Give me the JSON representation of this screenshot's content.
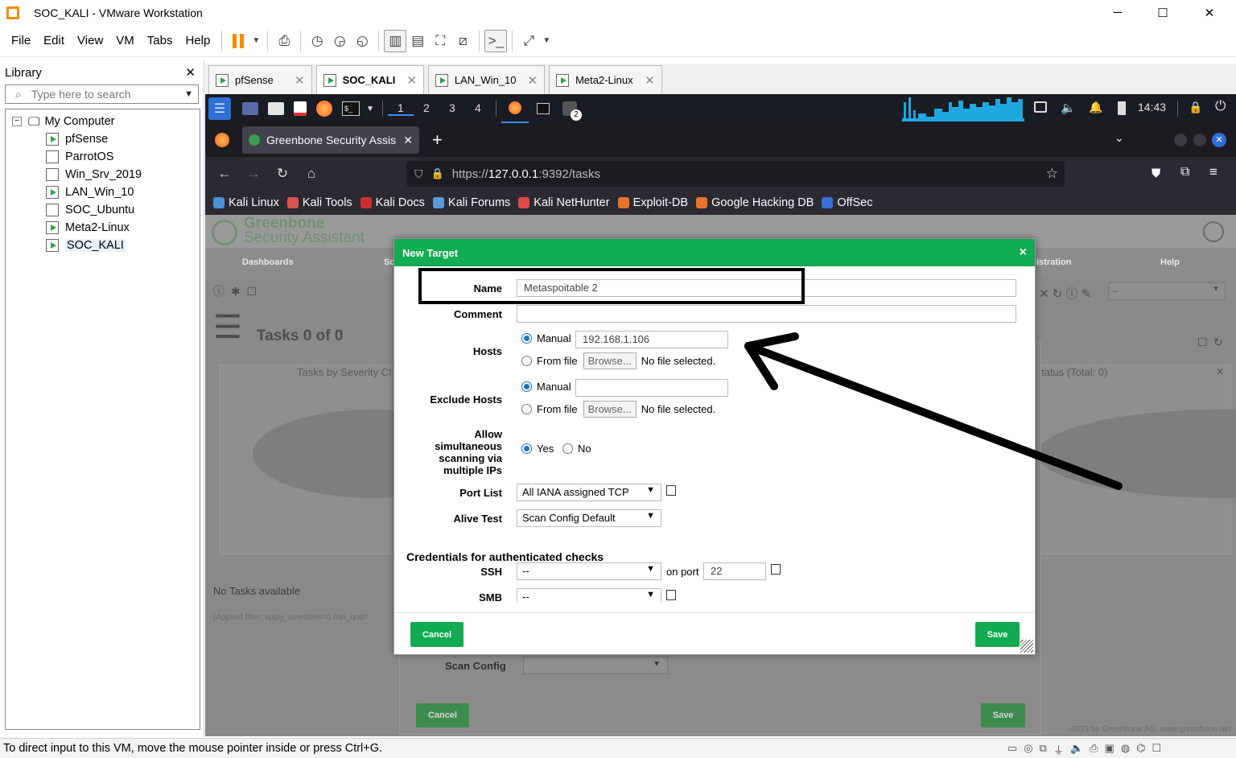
{
  "window": {
    "title": "SOC_KALI - VMware Workstation",
    "minimize": "─",
    "maximize": "☐",
    "close": "✕"
  },
  "menu": [
    "File",
    "Edit",
    "View",
    "VM",
    "Tabs",
    "Help"
  ],
  "library": {
    "title": "Library",
    "close": "✕",
    "search_placeholder": "Type here to search",
    "root": "My Computer",
    "items": [
      {
        "label": "pfSense",
        "running": true
      },
      {
        "label": "ParrotOS",
        "running": false
      },
      {
        "label": "Win_Srv_2019",
        "running": false
      },
      {
        "label": "LAN_Win_10",
        "running": true
      },
      {
        "label": "SOC_Ubuntu",
        "running": false
      },
      {
        "label": "Meta2-Linux",
        "running": true
      },
      {
        "label": "SOC_KALI",
        "running": true
      }
    ]
  },
  "vm_tabs": [
    {
      "label": "pfSense",
      "active": false
    },
    {
      "label": "SOC_KALI",
      "active": true
    },
    {
      "label": "LAN_Win_10",
      "active": false
    },
    {
      "label": "Meta2-Linux",
      "active": false
    }
  ],
  "kali_panel": {
    "workspaces": [
      "1",
      "2",
      "3",
      "4"
    ],
    "time": "14:43",
    "badge": "2"
  },
  "firefox": {
    "tab_title": "Greenbone Security Assis",
    "new_tab": "+",
    "url_prefix": "https://",
    "url_host": "127.0.0.1",
    "url_rest": ":9392/tasks",
    "bookmarks": [
      {
        "label": "Kali Linux",
        "color": "#4a90d9"
      },
      {
        "label": "Kali Tools",
        "color": "#d9534f"
      },
      {
        "label": "Kali Docs",
        "color": "#c9302c"
      },
      {
        "label": "Kali Forums",
        "color": "#5b9bd5"
      },
      {
        "label": "Kali NetHunter",
        "color": "#e04848"
      },
      {
        "label": "Exploit-DB",
        "color": "#e8742c"
      },
      {
        "label": "Google Hacking DB",
        "color": "#e8742c"
      },
      {
        "label": "OffSec",
        "color": "#3a6fd8"
      }
    ]
  },
  "gsa": {
    "logo_line1": "Greenbone",
    "logo_line2": "Security Assistant",
    "nav": [
      "Dashboards",
      "Sc",
      "istration",
      "Help"
    ],
    "tasks_title": "Tasks 0 of 0",
    "panel_left_title": "Tasks by Severity Cl",
    "panel_right_title": "tatus (Total: 0)",
    "no_tasks": "No Tasks available",
    "filter_text": "(Applied filter: apply_overrides=0 min_qod=",
    "copyright": "-2023 by Greenbone AG, www.greenbone.net",
    "filter_select": "--"
  },
  "under_dialog": {
    "scan_config_label": "Scan Config",
    "cancel": "Cancel",
    "save": "Save"
  },
  "dialog": {
    "title": "New Target",
    "close": "×",
    "name_label": "Name",
    "name_value": "Metaspoitable 2",
    "comment_label": "Comment",
    "comment_value": "",
    "hosts_label": "Hosts",
    "manual_label": "Manual",
    "hosts_value": "192.168.1.106",
    "from_file_label": "From file",
    "browse_label": "Browse...",
    "no_file": "No file selected.",
    "exclude_hosts_label": "Exclude Hosts",
    "exclude_value": "",
    "allow_label": "Allow simultaneous scanning via multiple IPs",
    "yes_label": "Yes",
    "no_label": "No",
    "port_list_label": "Port List",
    "port_list_value": "All IANA assigned TCP",
    "alive_test_label": "Alive Test",
    "alive_test_value": "Scan Config Default",
    "credentials_heading": "Credentials for authenticated checks",
    "ssh_label": "SSH",
    "ssh_value": "--",
    "on_port_label": "on port",
    "port_value": "22",
    "smb_label": "SMB",
    "smb_value": "--",
    "cancel": "Cancel",
    "save": "Save"
  },
  "status_bar": "To direct input to this VM, move the mouse pointer inside or press Ctrl+G."
}
